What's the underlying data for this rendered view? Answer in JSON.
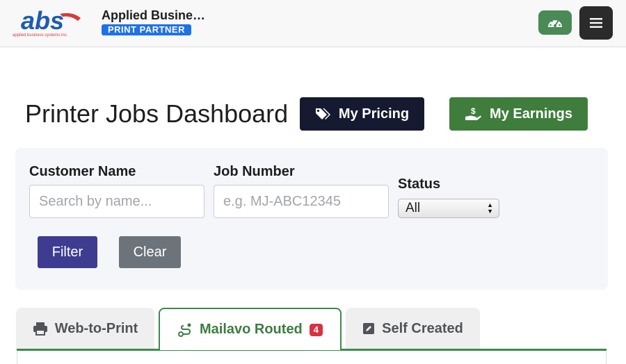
{
  "header": {
    "logo_text": "abs",
    "logo_tagline": "applied business systems inc.",
    "brand_name": "Applied Busine…",
    "badge": "PRINT PARTNER",
    "dashboard_icon": "gauge-icon",
    "menu_icon": "hamburger-menu-icon",
    "colors": {
      "badge": "#1f72e6",
      "gauge_button": "#4a8a57",
      "menu_button": "#2b2b2b"
    }
  },
  "page": {
    "title": "Printer Jobs Dashboard",
    "pricing_button": {
      "label": "My Pricing",
      "icon": "tags-icon",
      "color": "#161a30"
    },
    "earnings_button": {
      "label": "My Earnings",
      "icon": "hand-dollar-icon",
      "color": "#3f7d3c"
    }
  },
  "filters": {
    "customer_name": {
      "label": "Customer Name",
      "placeholder": "Search by name...",
      "value": ""
    },
    "job_number": {
      "label": "Job Number",
      "placeholder": "e.g. MJ-ABC12345",
      "value": ""
    },
    "status": {
      "label": "Status",
      "selected": "All"
    },
    "filter_button": "Filter",
    "clear_button": "Clear"
  },
  "tabs": [
    {
      "label": "Web-to-Print",
      "icon": "printer-icon",
      "active": false
    },
    {
      "label": "Mailavo Routed",
      "icon": "route-icon",
      "active": true,
      "badge": "4"
    },
    {
      "label": "Self Created",
      "icon": "edit-icon",
      "active": false
    }
  ]
}
